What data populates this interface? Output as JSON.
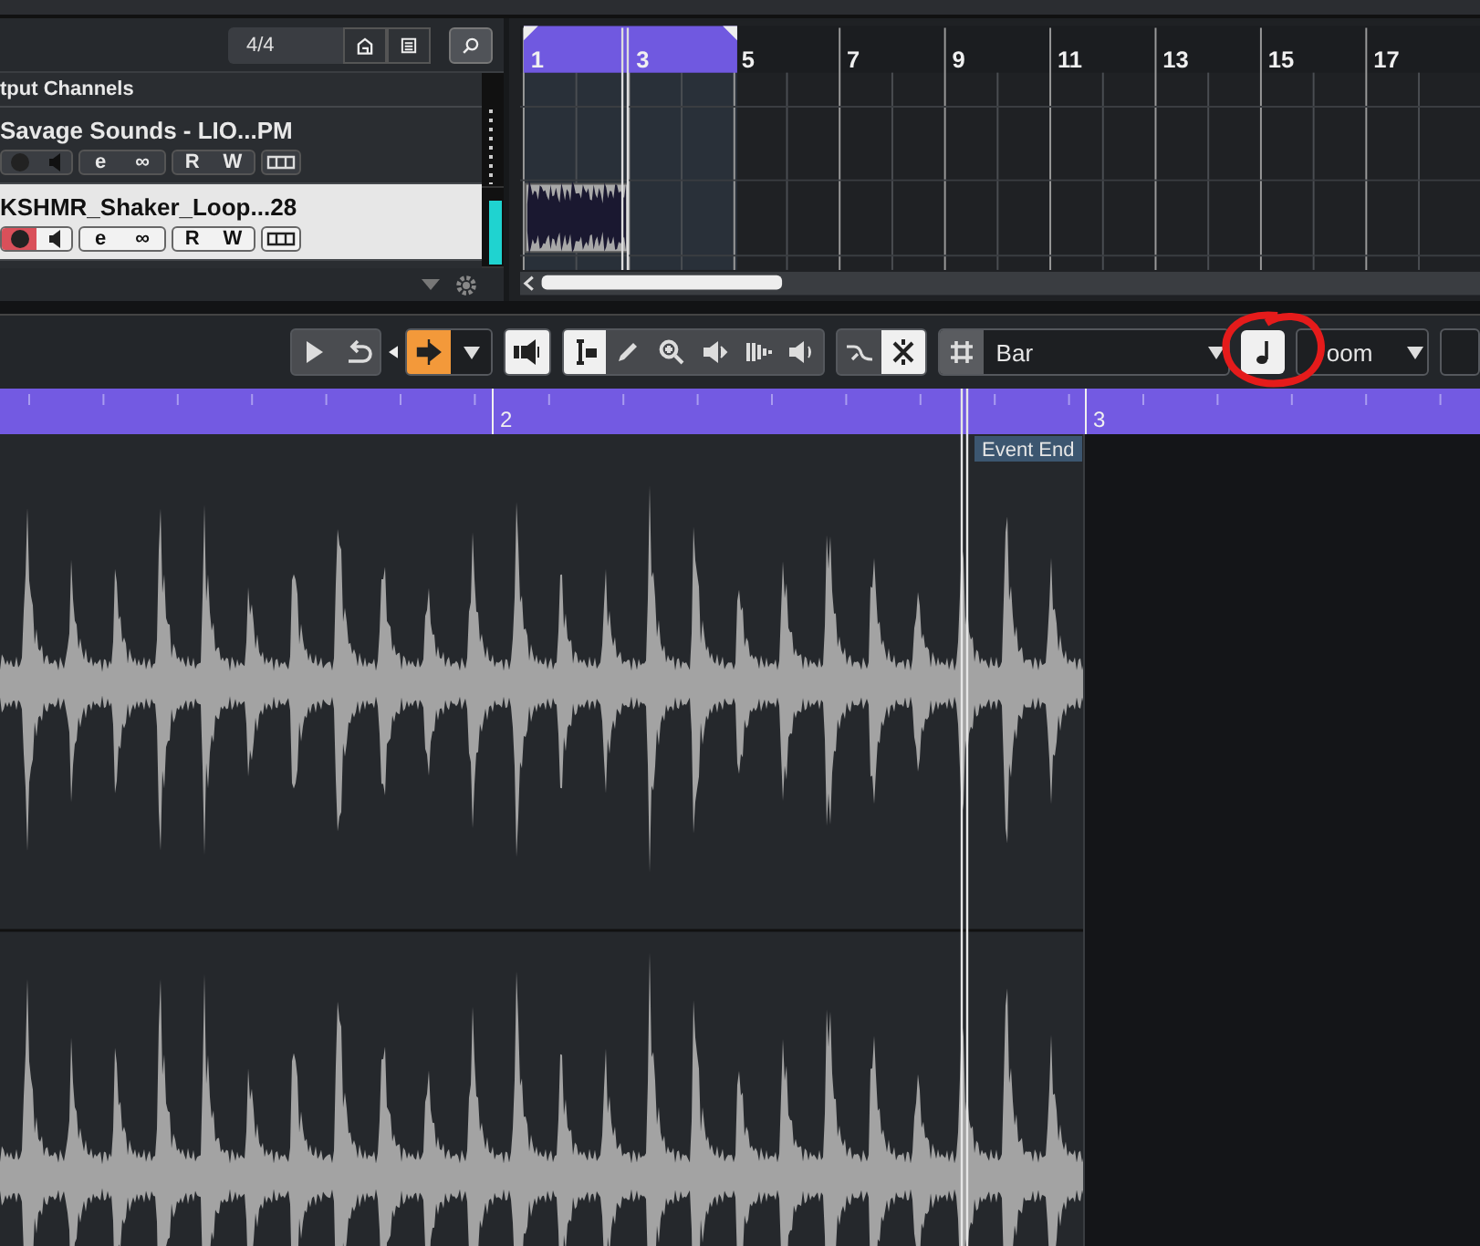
{
  "track_list": {
    "signature": "4/4",
    "folder_title": "tput Channels",
    "tracks": [
      {
        "name": "Savage Sounds - LIO...PM",
        "selected": false,
        "record_armed": false,
        "level": 0,
        "labels": {
          "edit": "e",
          "link": "∞",
          "read": "R",
          "write": "W"
        }
      },
      {
        "name": "KSHMR_Shaker_Loop...28",
        "selected": true,
        "record_armed": true,
        "level": 0.85,
        "labels": {
          "edit": "e",
          "link": "∞",
          "read": "R",
          "write": "W"
        }
      }
    ]
  },
  "arrange": {
    "ruler_marks": [
      "1",
      "3",
      "5",
      "7",
      "9",
      "11",
      "13",
      "15",
      "17"
    ]
  },
  "toolbar": {
    "groups": [
      {
        "buttons": [
          {
            "selected": false
          },
          {
            "selected": false
          }
        ]
      },
      {
        "buttons": [
          {
            "selected": true
          }
        ]
      },
      {
        "buttons": [
          {
            "selected": true
          }
        ]
      },
      {
        "buttons": [
          {
            "selected": true
          },
          {
            "selected": false
          },
          {
            "selected": false
          },
          {
            "selected": false
          },
          {
            "selected": false
          },
          {
            "selected": false
          }
        ]
      },
      {
        "buttons": [
          {
            "selected": false
          },
          {
            "selected": true
          }
        ]
      }
    ],
    "snap": {
      "grid_selected": false,
      "value": "Bar"
    },
    "quantize_note": {
      "selected": true
    },
    "zoom": {
      "value": "oom"
    }
  },
  "editor": {
    "ruler_marks": [
      "2",
      "3"
    ],
    "event_end_label": "Event End"
  }
}
